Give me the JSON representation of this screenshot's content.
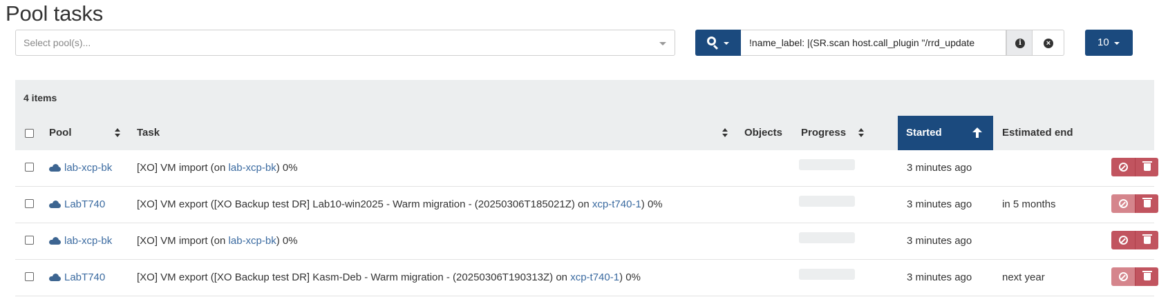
{
  "page": {
    "title": "Pool tasks"
  },
  "pool_select": {
    "placeholder": "Select pool(s)..."
  },
  "filter": {
    "value": "!name_label: |(SR.scan host.call_plugin \"/rrd_update"
  },
  "per_page": {
    "value": "10"
  },
  "table": {
    "items_count": "4 items",
    "columns": [
      "Pool",
      "Task",
      "Objects",
      "Progress",
      "Started",
      "Estimated end"
    ],
    "sorted_column": "Started",
    "rows": [
      {
        "pool": "lab-xcp-bk",
        "task_prefix": "[XO] VM import (on ",
        "task_link": "lab-xcp-bk",
        "task_suffix": ") 0%",
        "progress": 0,
        "started": "3 minutes ago",
        "estimated_end": "",
        "cancel_faded": false
      },
      {
        "pool": "LabT740",
        "task_prefix": "[XO] VM export ([XO Backup test DR] Lab10-win2025 - Warm migration - (20250306T185021Z) on ",
        "task_link": "xcp-t740-1",
        "task_suffix": ") 0%",
        "progress": 0,
        "started": "3 minutes ago",
        "estimated_end": "in 5 months",
        "cancel_faded": true
      },
      {
        "pool": "lab-xcp-bk",
        "task_prefix": "[XO] VM import (on ",
        "task_link": "lab-xcp-bk",
        "task_suffix": ") 0%",
        "progress": 0,
        "started": "3 minutes ago",
        "estimated_end": "",
        "cancel_faded": false
      },
      {
        "pool": "LabT740",
        "task_prefix": "[XO] VM export ([XO Backup test DR] Kasm-Deb - Warm migration - (20250306T190313Z) on ",
        "task_link": "xcp-t740-1",
        "task_suffix": ") 0%",
        "progress": 0,
        "started": "3 minutes ago",
        "estimated_end": "next year",
        "cancel_faded": true
      }
    ]
  },
  "colors": {
    "primary": "#1b4a7e",
    "danger": "#c1545f",
    "link": "#3a6aa0"
  },
  "icons": {
    "pool": "cloud-icon",
    "search": "search-icon",
    "info": "info-icon",
    "clear": "clear-icon",
    "cancel": "ban-icon",
    "delete": "trash-icon"
  }
}
